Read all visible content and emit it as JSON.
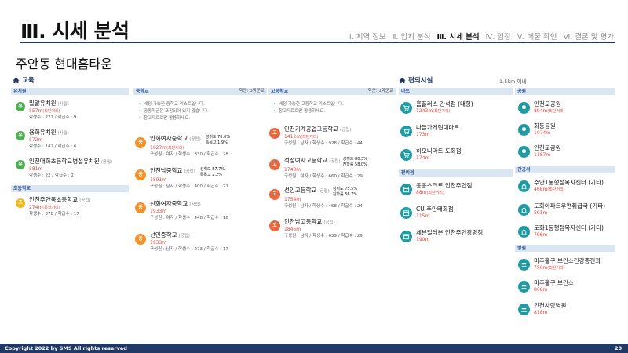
{
  "header": {
    "title": "Ⅲ. 시세 분석",
    "nav": [
      {
        "label": "Ⅰ. 지역 정보",
        "active": false
      },
      {
        "label": "Ⅱ. 입지 분석",
        "active": false
      },
      {
        "label": "Ⅲ. 시세 분석",
        "active": true
      },
      {
        "label": "Ⅳ. 임장",
        "active": false
      },
      {
        "label": "Ⅴ. 매물 확인",
        "active": false
      },
      {
        "label": "Ⅵ. 결론 및 평가",
        "active": false
      }
    ],
    "complex_name": "주안동 현대홈타운"
  },
  "education": {
    "heading": "교육",
    "kindergarten": {
      "label": "유치원",
      "items": [
        {
          "icon": "유",
          "name": "밀알유치원",
          "tag": "(사립)",
          "dist": "557m",
          "dnote": "(최단거리)",
          "sub": "학생수 : 221 / 학급수 : 9"
        },
        {
          "icon": "유",
          "name": "용화유치원",
          "tag": "(사립)",
          "dist": "572m",
          "dnote": "",
          "sub": "학생수 : 142 / 학급수 : 6"
        },
        {
          "icon": "유",
          "name": "인천대화초등학교병설유치원",
          "tag": "(공립)",
          "dist": "581m",
          "dnote": "",
          "sub": "학생수 : 22 / 학급수 : 2"
        }
      ]
    },
    "elementary": {
      "label": "초등학교",
      "items": [
        {
          "icon": "초",
          "name": "인천주안북초등학교",
          "tag": "(공립)",
          "dist": "274m",
          "dnote": "(통학거리)",
          "sub": "학생수 : 378 / 학급수 : 17"
        }
      ]
    },
    "middle": {
      "label": "중학교",
      "right": "학군: 3학군교",
      "notes": [
        "배정 가능한 중학교 리스트입니다.",
        "공동학군은 포함되어 있지 않습니다.",
        "참고자료로만 활용하세요."
      ],
      "items": [
        {
          "icon": "중",
          "name": "인화여자중학교",
          "tag": "(공립)",
          "dist": "1627m",
          "dnote": "(최단거리)",
          "sub": "구성원 : 여자 / 학생수 : 830 / 학급수 : 28",
          "stat1": "성취도 70.0%",
          "stat2": "특목고 1.9%"
        },
        {
          "icon": "중",
          "name": "인천남중학교",
          "tag": "(공립)",
          "dist": "1891m",
          "dnote": "",
          "sub": "구성원 : 남자 / 학생수 : 400 / 학급수 : 21",
          "stat1": "성취도 57.7%",
          "stat2": "특목고 2.2%"
        },
        {
          "icon": "중",
          "name": "선화여자중학교",
          "tag": "(공립)",
          "dist": "1933m",
          "dnote": "",
          "sub": "구성원 : 여자 / 학생수 : 448 / 학급수 : 18",
          "stat1": "",
          "stat2": ""
        },
        {
          "icon": "중",
          "name": "선인중학교",
          "tag": "(공립)",
          "dist": "1933m",
          "dnote": "",
          "sub": "구성원 : 남자 / 학생수 : 273 / 학급수 : 17",
          "stat1": "",
          "stat2": ""
        }
      ]
    },
    "high": {
      "label": "고등학교",
      "right": "학군: 1학군교",
      "notes": [
        "배정 가능한 고등학교 리스트입니다.",
        "참고자료로만 활용하세요."
      ],
      "items": [
        {
          "icon": "고",
          "name": "인천기계공업고등학교",
          "tag": "(공립)",
          "dist": "1412m",
          "dnote": "(최단거리)",
          "sub": "구성원 : 남자 / 학생수 : 928 / 학급수 : 44",
          "stat1": "",
          "stat2": ""
        },
        {
          "icon": "고",
          "name": "석정여자고등학교",
          "tag": "(공립)",
          "dist": "1740m",
          "dnote": "",
          "sub": "구성원 : 여자 / 학생수 : 660 / 학급수 : 29",
          "stat1": "성취도 80.3%",
          "stat2": "진학률 58.0%"
        },
        {
          "icon": "고",
          "name": "선인고등학교",
          "tag": "(공립)",
          "dist": "1754m",
          "dnote": "",
          "sub": "구성원 : 남자 / 학생수 : 458 / 학급수 : 24",
          "stat1": "성취도 75.5%",
          "stat2": "진학률 56.7%"
        },
        {
          "icon": "고",
          "name": "인천남고등학교",
          "tag": "(공립)",
          "dist": "1845m",
          "dnote": "",
          "sub": "구성원 : 남자 / 학생수 : 659 / 학급수 : 29",
          "stat1": "",
          "stat2": ""
        }
      ]
    }
  },
  "facilities": {
    "heading": "편의시설",
    "radius": "1.5km 이내",
    "mart": {
      "label": "마트",
      "items": [
        {
          "icon": "cart-icon",
          "name": "홈플러스 간석점 (대형)",
          "dist": "1243m",
          "dnote": "(최단거리)"
        },
        {
          "icon": "cart-icon",
          "name": "나들가게현대마트",
          "dist": "173m",
          "dnote": ""
        },
        {
          "icon": "cart-icon",
          "name": "하모니마트 도화점",
          "dist": "174m",
          "dnote": ""
        }
      ]
    },
    "convenience": {
      "label": "편의점",
      "items": [
        {
          "icon": "store-icon",
          "name": "응응스크르 인천주안점",
          "dist": "88m",
          "dnote": "(최단거리)"
        },
        {
          "icon": "store-icon",
          "name": "CU 주안태화점",
          "dist": "115m",
          "dnote": ""
        },
        {
          "icon": "store-icon",
          "name": "세븐일레븐 인천주안광명점",
          "dist": "190m",
          "dnote": ""
        }
      ]
    },
    "park": {
      "label": "공원",
      "items": [
        {
          "icon": "park-icon",
          "name": "인천교공원",
          "dist": "894m",
          "dnote": "(최단거리)"
        },
        {
          "icon": "park-icon",
          "name": "화동공원",
          "dist": "1074m",
          "dnote": ""
        },
        {
          "icon": "park-icon",
          "name": "인천교공원",
          "dist": "1187m",
          "dnote": ""
        }
      ]
    },
    "government": {
      "label": "관공서",
      "items": [
        {
          "icon": "building-icon",
          "name": "주안1동행정복지센터 (기타)",
          "dist": "468m",
          "dnote": "(최단거리)"
        },
        {
          "icon": "building-icon",
          "name": "도화아파트우편취급국 (기타)",
          "dist": "591m",
          "dnote": ""
        },
        {
          "icon": "building-icon",
          "name": "도화1동행정복지센터 (기타)",
          "dist": "796m",
          "dnote": ""
        }
      ]
    },
    "hospital": {
      "label": "병원",
      "items": [
        {
          "icon": "people-icon",
          "name": "미추홀구 보건소건강증진과",
          "dist": "796m",
          "dnote": "(최단거리)"
        },
        {
          "icon": "people-icon",
          "name": "미추홀구 보건소",
          "dist": "808m",
          "dnote": ""
        },
        {
          "icon": "people-icon",
          "name": "인천사랑병원",
          "dist": "818m",
          "dnote": ""
        }
      ]
    }
  },
  "footer": {
    "copyright": "Copyright 2022 by SMS All rights reserved",
    "page": "28"
  },
  "colors": {
    "navy": "#1f3864",
    "teal": "#1f9ba3",
    "distance_red": "#e0483b",
    "bar_bg": "#dbe6f3"
  }
}
